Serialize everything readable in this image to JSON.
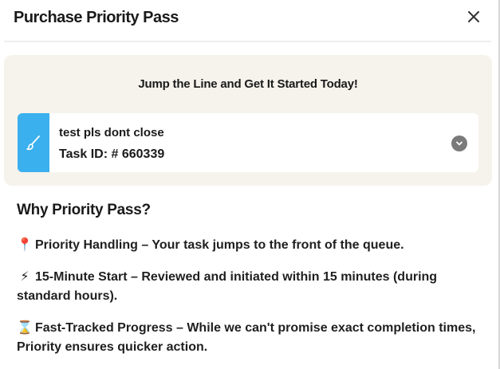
{
  "header": {
    "title": "Purchase Priority Pass"
  },
  "promo": {
    "heading": "Jump the Line and Get It Started Today!"
  },
  "task": {
    "name": "test pls dont close",
    "id_text": "Task ID: # 660339",
    "icon": "paintbrush-icon",
    "icon_bg_color": "#3bb0ee"
  },
  "why": {
    "heading": "Why Priority Pass?",
    "benefits": [
      {
        "emoji": "📍",
        "icon": "pin-icon",
        "text": "Priority Handling – Your task jumps to the front of the queue."
      },
      {
        "emoji": "⚡",
        "icon": "lightning-icon",
        "text": "15-Minute Start – Reviewed and initiated within 15 minutes (during standard hours)."
      },
      {
        "emoji": "⌛",
        "icon": "hourglass-icon",
        "text": "Fast-Tracked Progress – While we can't promise exact completion times, Priority ensures quicker action."
      }
    ]
  },
  "colors": {
    "promo_bg": "#f5f3ec",
    "accent_blue": "#3bb0ee"
  }
}
